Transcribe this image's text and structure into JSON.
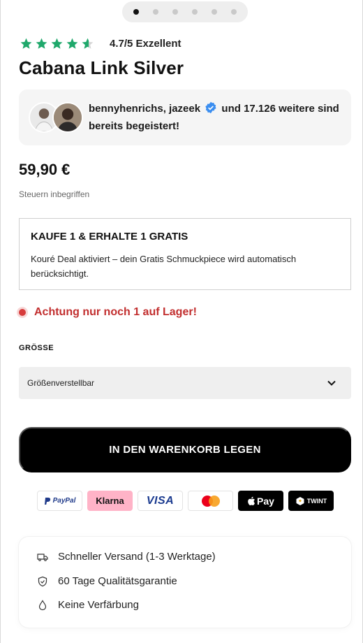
{
  "carousel": {
    "count": 6,
    "active_index": 0
  },
  "rating": {
    "text": "4.7/5 Exzellent",
    "value": 4.7,
    "max": 5,
    "star_color": "#1fa86b"
  },
  "product": {
    "title": "Cabana Link Silver",
    "price": "59,90 €",
    "tax_note": "Steuern inbegriffen"
  },
  "social_proof": {
    "names": "bennyhenrichs, jazeek",
    "rest": "und 17.126 weitere sind bereits begeistert!"
  },
  "deal": {
    "title": "KAUFE 1 & ERHALTE 1 GRATIS",
    "description": "Kouré Deal aktiviert – dein Gratis Schmuckpiece wird automatisch berücksichtigt."
  },
  "stock": {
    "text": "Achtung nur noch 1 auf Lager!",
    "color": "#c22f2f"
  },
  "size": {
    "label": "GRÖSSE",
    "selected": "Größenverstellbar"
  },
  "cart_button": {
    "label": "IN DEN WARENKORB LEGEN"
  },
  "payments": {
    "paypal": "PayPal",
    "klarna": "Klarna",
    "visa": "VISA",
    "mastercard_icon": "mastercard-icon",
    "applepay": "Pay",
    "twint": "TWINT"
  },
  "benefits": [
    {
      "icon": "truck-icon",
      "text": "Schneller Versand (1-3 Werktage)"
    },
    {
      "icon": "shield-check-icon",
      "text": "60 Tage Qualitätsgarantie"
    },
    {
      "icon": "drop-icon",
      "text": "Keine Verfärbung"
    }
  ]
}
